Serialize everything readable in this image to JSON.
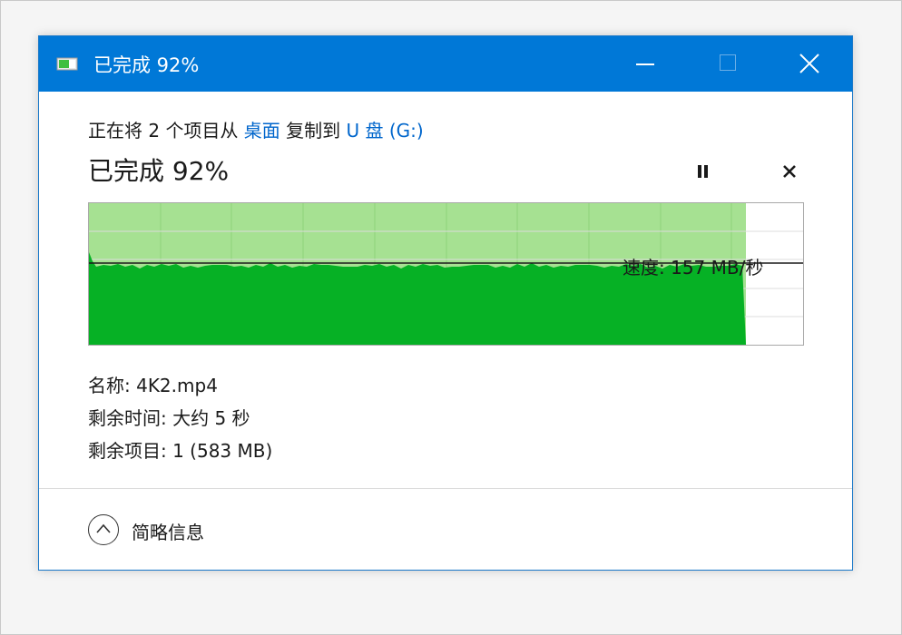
{
  "window": {
    "title": "已完成 92%"
  },
  "header": {
    "prefix": "正在将 2 个项目从 ",
    "source": "桌面",
    "middle": " 复制到 ",
    "destination": "U 盘 (G:)"
  },
  "progress": {
    "title": "已完成 92%",
    "percent": 92
  },
  "speed": {
    "label": "速度: 157 MB/秒",
    "level": 0.58
  },
  "details": {
    "name": "名称: 4K2.mp4",
    "time_remaining": "剩余时间: 大约 5 秒",
    "items_remaining": "剩余项目: 1 (583 MB)"
  },
  "footer": {
    "less_info_label": "简略信息"
  },
  "colors": {
    "titlebar": "#0078d7",
    "progress_light": "#a6e192",
    "progress_dark": "#06b125",
    "link": "#0066cc"
  }
}
